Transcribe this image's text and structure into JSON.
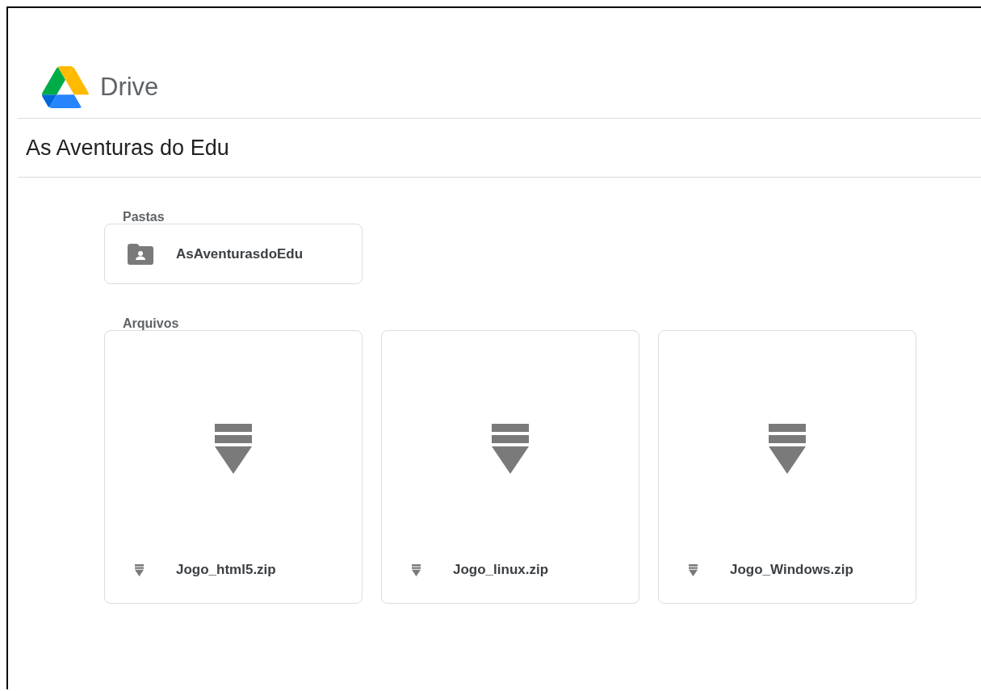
{
  "header": {
    "app_name": "Drive"
  },
  "title": "As Aventuras do Edu",
  "sections": [
    {
      "heading": "Pastas",
      "kind": "folders",
      "items": [
        {
          "name": "AsAventurasdoEdu"
        }
      ]
    },
    {
      "heading": "Arquivos",
      "kind": "files",
      "items": [
        {
          "name": "Jogo_html5.zip"
        },
        {
          "name": "Jogo_linux.zip"
        },
        {
          "name": "Jogo_Windows.zip"
        }
      ]
    }
  ]
}
